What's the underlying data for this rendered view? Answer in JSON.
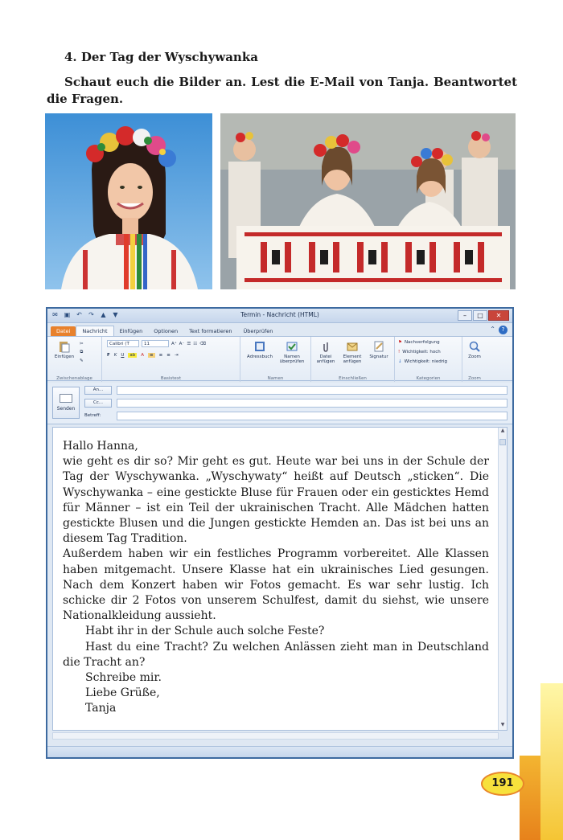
{
  "section": {
    "heading": "4. Der Tag der Wyschywanka",
    "instruction": "Schaut euch die Bilder an. Lest die E-Mail von Tanja. Beantwortet die Fragen."
  },
  "window": {
    "title": "Termin - Nachricht (HTML)",
    "tabs": [
      "Datei",
      "Nachricht",
      "Einfügen",
      "Optionen",
      "Text formatieren",
      "Überprüfen"
    ]
  },
  "ribbon": {
    "paste": "Einfügen",
    "clipboard_group": "Zwischenablage",
    "font_name": "Calibri (T",
    "font_size": "11",
    "basic_text_group": "Basistext",
    "addressbook": "Adressbuch",
    "check_names": "Namen überprüfen",
    "names_group": "Namen",
    "attach_file": "Datei anfügen",
    "attach_item": "Element anfügen",
    "signature": "Signatur",
    "include_group": "Einschließen",
    "followup": "Nachverfolgung",
    "importance_high": "Wichtigkeit: hoch",
    "importance_low": "Wichtigkeit: niedrig",
    "categories_group": "Kategorien",
    "zoom": "Zoom",
    "zoom_group": "Zoom"
  },
  "compose": {
    "send": "Senden",
    "to": "An...",
    "cc": "Cc...",
    "subject": "Betreff:"
  },
  "mail": {
    "greeting": "Hallo Hanna,",
    "p1": "wie geht es dir so? Mir geht es gut. Heute war bei uns in der Schule der Tag der Wyschywanka. „Wyschywaty“ heißt auf Deutsch „sticken“. Die Wyschywanka – eine gestickte Bluse für Frauen oder ein gesticktes Hemd für Männer – ist ein Teil der ukrainischen Tracht. Alle Mädchen hatten gestickte Blusen und die Jungen gestickte Hemden an. Das ist bei uns an diesem Tag Tradition.",
    "p2": "Außerdem haben wir ein festliches Programm vorbereitet. Alle Klassen haben mitgemacht. Unsere Klasse hat ein ukrainisches Lied gesungen. Nach dem Konzert haben wir Fotos gemacht. Es war sehr lustig. Ich schicke dir 2 Fotos von unserem Schulfest, damit du siehst, wie unsere Nationalkleidung aussieht.",
    "q1": "Habt ihr in der Schule auch solche Feste?",
    "q2": "Hast du eine Tracht? Zu welchen Anlässen zieht man in Deutschland die Tracht an?",
    "closing1": "Schreibe mir.",
    "closing2": "Liebe Grüße,",
    "signature": "Tanja"
  },
  "page_number": "191",
  "colors": {
    "file_tab": "#e8812c",
    "window_border": "#3d6aa0",
    "page_number_fill": "#f7e13c"
  }
}
